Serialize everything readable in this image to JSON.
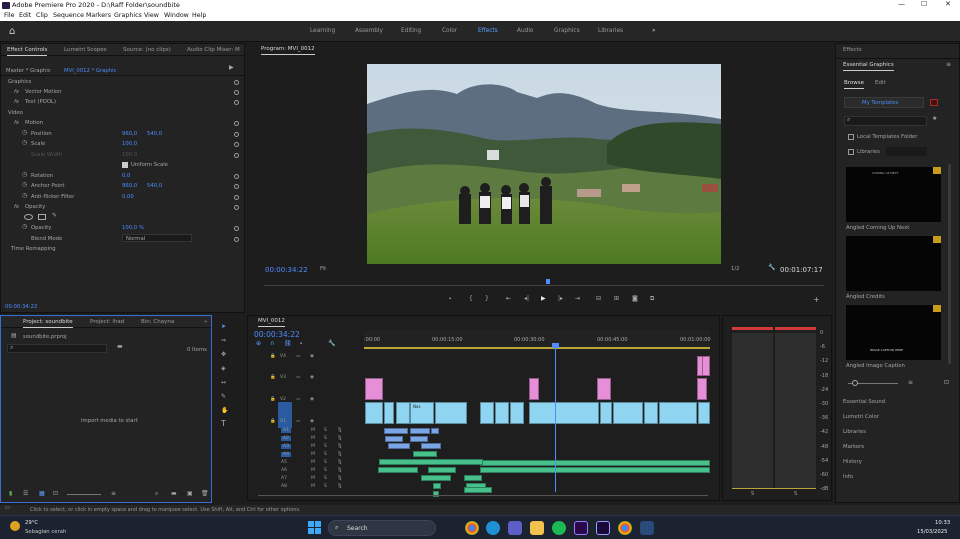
{
  "window": {
    "title": "Adobe Premiere Pro 2020 - D:\\Raff Folder\\soundbite"
  },
  "menu": [
    "File",
    "Edit",
    "Clip",
    "Sequence",
    "Markers",
    "Graphics",
    "View",
    "Window",
    "Help"
  ],
  "workspaces": [
    "Learning",
    "Assembly",
    "Editing",
    "Color",
    "Effects",
    "Audio",
    "Graphics",
    "Libraries"
  ],
  "active_workspace": "Effects",
  "effect_controls": {
    "tabs": [
      "Effect Controls",
      "Lumetri Scopes",
      "Source: (no clips)",
      "Audio Clip Mixer: M"
    ],
    "source": "Master * Graphic",
    "clip": "MVI_0012 * Graphic",
    "graphics_label": "Graphics",
    "vector_motion": "Vector Motion",
    "text_pool": "Text (POOL)",
    "video_label": "Video",
    "motion": "Motion",
    "position_label": "Position",
    "position_x": "960,0",
    "position_y": "540,0",
    "scale_label": "Scale",
    "scale_val": "100,0",
    "scale_width_label": "Scale Width",
    "scale_width_val": "100,0",
    "uniform_scale": "Uniform Scale",
    "rotation_label": "Rotation",
    "rotation_val": "0,0",
    "anchor_label": "Anchor Point",
    "anchor_x": "960,0",
    "anchor_y": "540,0",
    "flicker_label": "Anti-flicker Filter",
    "flicker_val": "0,00",
    "opacity_section": "Opacity",
    "opacity_label": "Opacity",
    "opacity_val": "100,0 %",
    "blend_label": "Blend Mode",
    "blend_val": "Normal",
    "time_remap": "Time Remapping",
    "timecode": "00:00:34:22"
  },
  "program": {
    "tab": "Program: MVI_0012",
    "timecode": "00:00:34:22",
    "fit": "Fit",
    "resolution": "1/2",
    "duration": "00:01:07:17"
  },
  "project": {
    "tabs": [
      "Project: soundbite",
      "Project: ihad",
      "Bin: Chayna"
    ],
    "file": "soundbite.prproj",
    "items": "0 Items",
    "empty_msg": "Import media to start"
  },
  "timeline": {
    "tab": "MVI_0012",
    "timecode": "00:00:34:22",
    "ruler": [
      ":00:00",
      "00:00:15:00",
      "00:00:30:00",
      "00:00:45:00",
      "00:01:00:00"
    ],
    "video_tracks": [
      "V4",
      "V3",
      "V2",
      "V1"
    ],
    "audio_tracks": [
      "A1",
      "A2",
      "A3",
      "A4",
      "A5",
      "A6",
      "A7",
      "A8"
    ],
    "clip_label": "fx",
    "clip_label2": "Nas"
  },
  "meter_scale": [
    "0",
    "-6",
    "-12",
    "-18",
    "-24",
    "-30",
    "-36",
    "-42",
    "-48",
    "-54",
    "-60",
    "-dB"
  ],
  "meter_footer": [
    "S",
    "S"
  ],
  "effects_panel": {
    "header": "Effects",
    "title": "Essential Graphics",
    "tabs": [
      "Browse",
      "Edit"
    ],
    "my_templates": "My Templates",
    "local": "Local Templates Folder",
    "libraries": "Libraries",
    "templates": [
      "Angled Coming Up Next",
      "Angled Credits",
      "Angled Image Caption"
    ],
    "template_texts": [
      "COMING UP NEXT",
      "IMAGE CAPTION HERE"
    ],
    "sections": [
      "Essential Sound",
      "Lumetri Color",
      "Libraries",
      "Markers",
      "History",
      "Info"
    ]
  },
  "status": "Click to select, or click in empty space and drag to marquee select. Use Shift, Alt, and Ctrl for other options.",
  "taskbar": {
    "temp": "29°C",
    "weather": "Sebagian cerah",
    "search": "Search",
    "time": "10:33",
    "date": "15/03/2025"
  }
}
